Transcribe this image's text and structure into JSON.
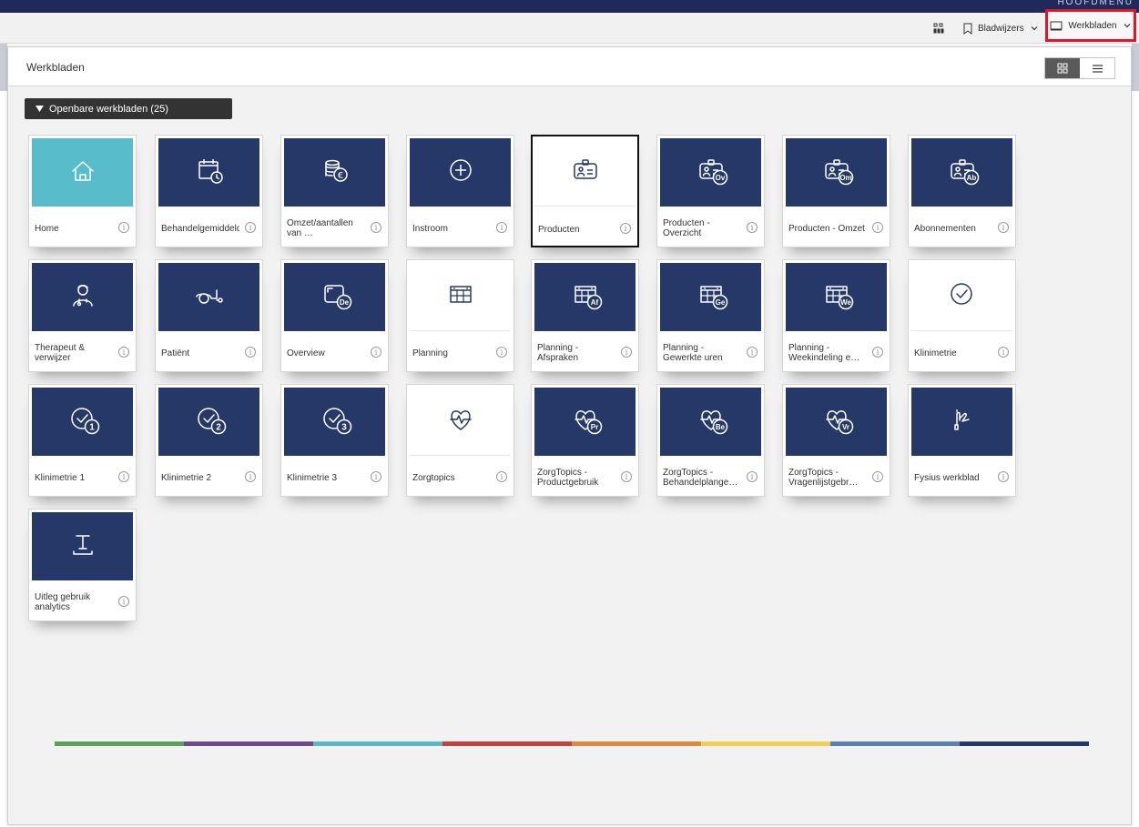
{
  "topbar": {
    "corner_text": "HOOFDMENU"
  },
  "toolbar": {
    "apps_icon": "grid-apps-icon",
    "bookmarks_label": "Bladwijzers",
    "worksheets_label": "Werkbladen",
    "highlight_color": "#e0162b"
  },
  "panel": {
    "title": "Werkbladen",
    "view_options": [
      "grid",
      "list"
    ],
    "active_view": "grid"
  },
  "group": {
    "label": "Openbare werkbladen (25)"
  },
  "tiles": [
    {
      "label": "Home",
      "style": "teal",
      "icon": "home-icon"
    },
    {
      "label": "Behandelgemiddelden",
      "style": "navy",
      "icon": "calendar-clock-icon"
    },
    {
      "label": "Omzet/aantallen van …",
      "style": "navy",
      "icon": "coins-euro-icon"
    },
    {
      "label": "Instroom",
      "style": "navy",
      "icon": "plus-circle-icon"
    },
    {
      "label": "Producten",
      "style": "white",
      "icon": "id-badge-icon",
      "selected": true
    },
    {
      "label": "Producten - Overzicht",
      "style": "navy",
      "icon": "id-badge-icon",
      "badge": "Ov"
    },
    {
      "label": "Producten - Omzet",
      "style": "navy",
      "icon": "id-badge-icon",
      "badge": "Om"
    },
    {
      "label": "Abonnementen",
      "style": "navy",
      "icon": "id-badge-icon",
      "badge": "Ab"
    },
    {
      "label": "Therapeut & verwijzer",
      "style": "navy",
      "icon": "doctor-icon"
    },
    {
      "label": "Patiënt",
      "style": "navy",
      "icon": "wheelchair-icon"
    },
    {
      "label": "Overview",
      "style": "navy",
      "icon": "screen-icon",
      "badge": "De"
    },
    {
      "label": "Planning",
      "style": "white",
      "icon": "planning-grid-icon"
    },
    {
      "label": "Planning - Afspraken",
      "style": "navy",
      "icon": "planning-grid-icon",
      "badge": "Af"
    },
    {
      "label": "Planning - Gewerkte uren",
      "style": "navy",
      "icon": "planning-grid-icon",
      "badge": "Ge"
    },
    {
      "label": "Planning - Weekindeling e…",
      "style": "navy",
      "icon": "planning-grid-icon",
      "badge": "We"
    },
    {
      "label": "Klinimetrie",
      "style": "white",
      "icon": "check-circle-icon"
    },
    {
      "label": "Klinimetrie 1",
      "style": "navy",
      "icon": "check-circle-icon",
      "badge": "1"
    },
    {
      "label": "Klinimetrie 2",
      "style": "navy",
      "icon": "check-circle-icon",
      "badge": "2"
    },
    {
      "label": "Klinimetrie 3",
      "style": "navy",
      "icon": "check-circle-icon",
      "badge": "3"
    },
    {
      "label": "Zorgtopics",
      "style": "white",
      "icon": "heart-pulse-icon"
    },
    {
      "label": "ZorgTopics - Productgebruik",
      "style": "navy",
      "icon": "heart-pulse-icon",
      "badge": "Pr"
    },
    {
      "label": "ZorgTopics - Behandelplange…",
      "style": "navy",
      "icon": "heart-pulse-icon",
      "badge": "Be"
    },
    {
      "label": "ZorgTopics - Vragenlijstgebr…",
      "style": "navy",
      "icon": "heart-pulse-icon",
      "badge": "Vr"
    },
    {
      "label": "Fysius werkblad",
      "style": "navy",
      "icon": "hand-pointer-icon"
    },
    {
      "label": "Uitleg gebruik analytics",
      "style": "navy",
      "icon": "text-tool-icon"
    }
  ],
  "info_glyph": "i",
  "colors": {
    "navy": "#253868",
    "teal": "#58bccb",
    "colorbar": [
      "#5aa15a",
      "#6a4b8c",
      "#5bb8c6",
      "#c8403f",
      "#e08a3c",
      "#f2cf52",
      "#5a82b8",
      "#253868"
    ]
  }
}
